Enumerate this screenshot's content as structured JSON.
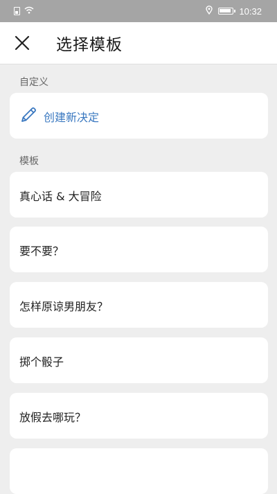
{
  "status_bar": {
    "time": "10:32",
    "icons": [
      "sim-icon",
      "wifi-icon",
      "location-icon",
      "battery-icon"
    ]
  },
  "app_bar": {
    "title": "选择模板",
    "close_icon": "close-icon"
  },
  "custom_section": {
    "label": "自定义",
    "create_label": "创建新决定",
    "create_icon": "pencil-icon"
  },
  "templates_section": {
    "label": "模板",
    "items": [
      {
        "label": "真心话 & 大冒险"
      },
      {
        "label": "要不要？"
      },
      {
        "label": "怎样原谅男朋友？"
      },
      {
        "label": "掷个骰子"
      },
      {
        "label": "放假去哪玩？"
      },
      {
        "label": ""
      }
    ]
  },
  "colors": {
    "status_bar": "#a5a5a5",
    "background": "#eeeeee",
    "card": "#ffffff",
    "accent": "#3a78c0"
  }
}
